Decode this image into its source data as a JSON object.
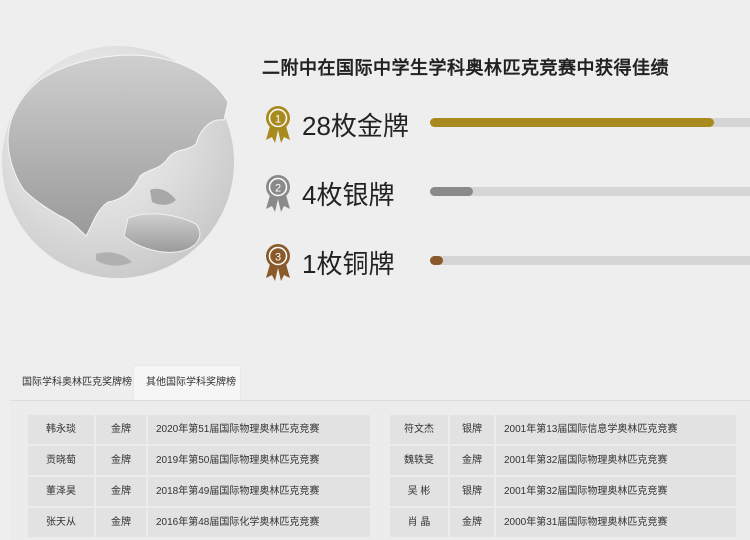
{
  "title": "二附中在国际中学生学科奥林匹克竞赛中获得佳绩",
  "medals": [
    {
      "icon_number": "1",
      "label": "28枚金牌",
      "progress": 0.86,
      "color": "#a88a1e",
      "icon": "gold-medal-icon"
    },
    {
      "icon_number": "2",
      "label": "4枚银牌",
      "progress": 0.13,
      "color": "#8a8a8a",
      "icon": "silver-medal-icon"
    },
    {
      "icon_number": "3",
      "label": "1枚铜牌",
      "progress": 0.04,
      "color": "#8b5a2b",
      "icon": "bronze-medal-icon"
    }
  ],
  "tabs": [
    {
      "label": "国际学科奥林匹克奖牌榜",
      "active": true
    },
    {
      "label": "其他国际学科奖牌榜",
      "active": false
    }
  ],
  "table_left": [
    {
      "name": "韩永琰",
      "medal": "金牌",
      "event": "2020年第51届国际物理奥林匹克竞赛"
    },
    {
      "name": "贡晓萄",
      "medal": "金牌",
      "event": "2019年第50届国际物理奥林匹克竞赛"
    },
    {
      "name": "董泽昊",
      "medal": "金牌",
      "event": "2018年第49届国际物理奥林匹克竞赛"
    },
    {
      "name": "张天从",
      "medal": "金牌",
      "event": "2016年第48届国际化学奥林匹克竞赛"
    }
  ],
  "table_right": [
    {
      "name": "符文杰",
      "medal": "银牌",
      "event": "2001年第13届国际信息学奥林匹克竞赛"
    },
    {
      "name": "魏轶旻",
      "medal": "金牌",
      "event": "2001年第32届国际物理奥林匹克竞赛"
    },
    {
      "name": "吴 彬",
      "medal": "银牌",
      "event": "2001年第32届国际物理奥林匹克竞赛"
    },
    {
      "name": "肖 晶",
      "medal": "金牌",
      "event": "2000年第31届国际物理奥林匹克竞赛"
    }
  ]
}
